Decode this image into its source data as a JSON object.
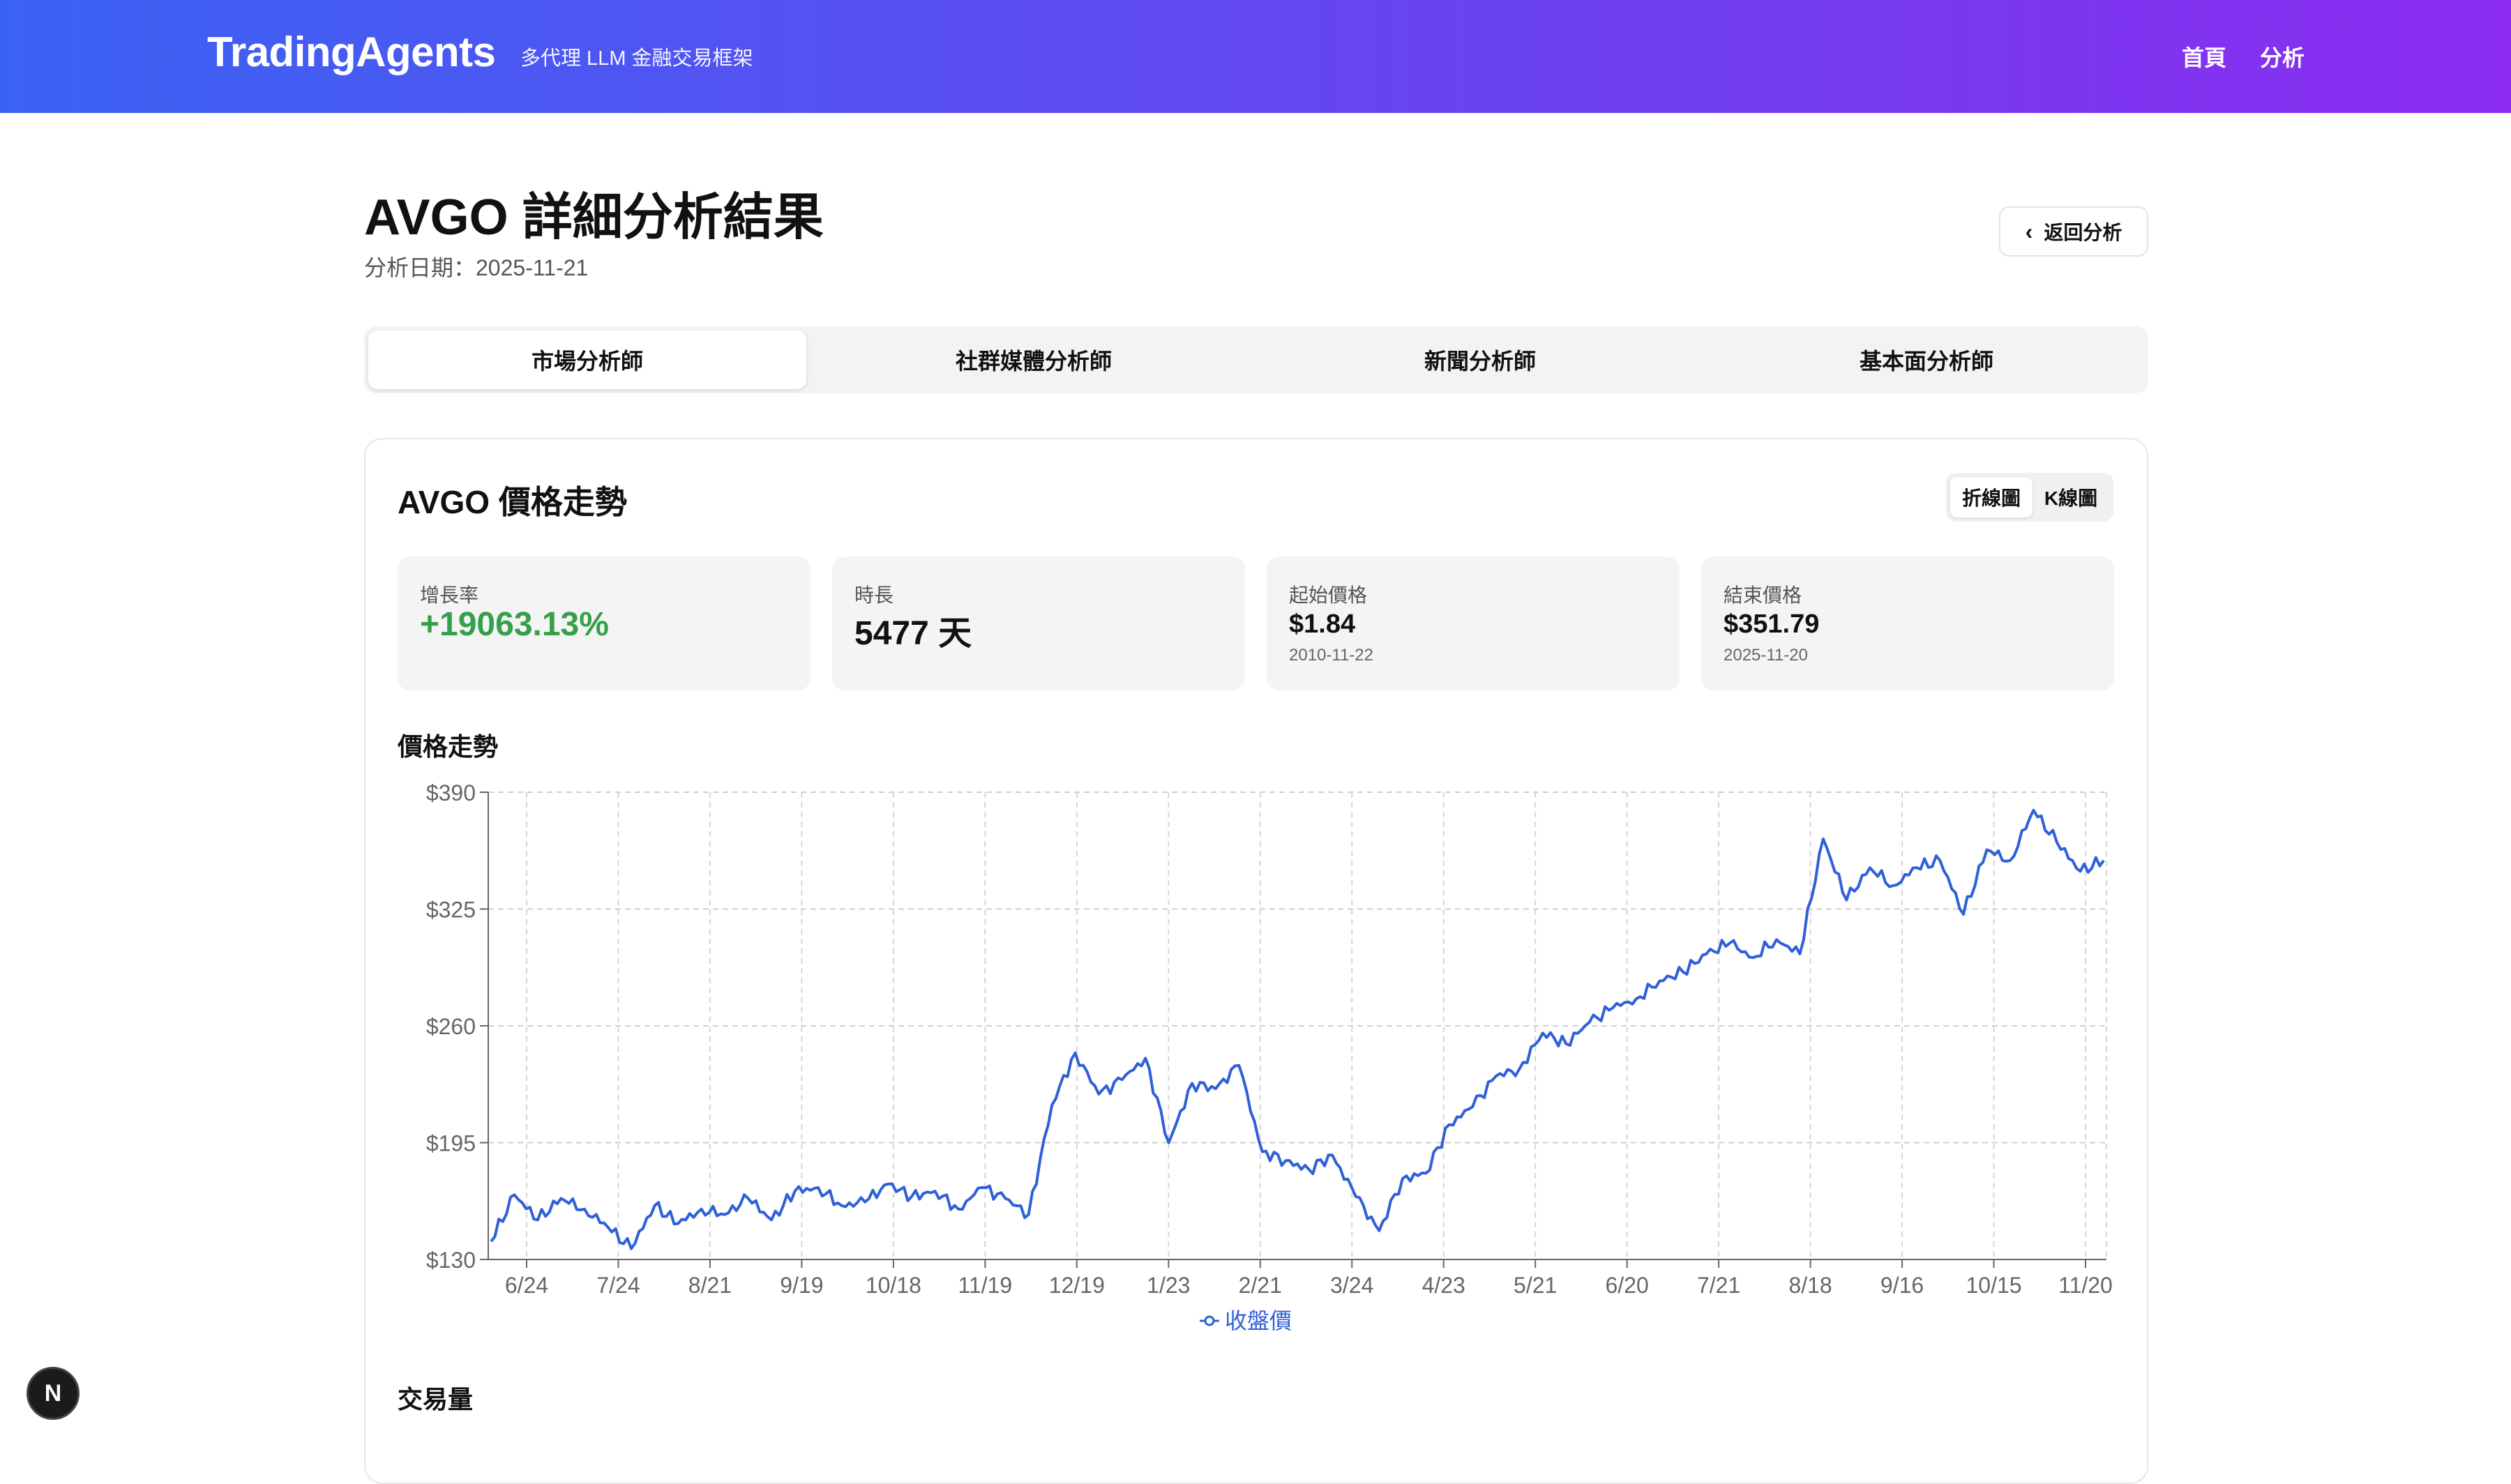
{
  "header": {
    "brand": "TradingAgents",
    "subtitle": "多代理 LLM 金融交易框架",
    "nav": {
      "home": "首頁",
      "analysis": "分析"
    }
  },
  "page": {
    "title": "AVGO 詳細分析結果",
    "date": "分析日期：2025-11-21",
    "back_label": "返回分析"
  },
  "tabs": [
    "市場分析師",
    "社群媒體分析師",
    "新聞分析師",
    "基本面分析師"
  ],
  "card": {
    "title": "AVGO 價格走勢",
    "toggle": [
      "折線圖",
      "K線圖"
    ]
  },
  "stats": [
    {
      "label": "增長率",
      "value": "+19063.13%",
      "date": ""
    },
    {
      "label": "時長",
      "value": "5477 天",
      "date": ""
    },
    {
      "label": "起始價格",
      "value": "$1.84",
      "date": "2010-11-22"
    },
    {
      "label": "結束價格",
      "value": "$351.79",
      "date": "2025-11-20"
    }
  ],
  "sections": {
    "price": "價格走勢",
    "volume": "交易量"
  },
  "badge": "N",
  "colors": {
    "line": "#3060d8",
    "growth": "#34a14a"
  },
  "chart_data": {
    "type": "line",
    "title": "價格走勢",
    "x": [
      "6/24",
      "7/24",
      "8/21",
      "9/19",
      "10/18",
      "11/19",
      "12/19",
      "1/23",
      "2/21",
      "3/24",
      "4/23",
      "5/21",
      "6/20",
      "7/21",
      "8/18",
      "9/16",
      "10/15",
      "11/20"
    ],
    "y_ticks": [
      "$390",
      "$325",
      "$260",
      "$195",
      "$130"
    ],
    "ylim": [
      130,
      390
    ],
    "grid": true,
    "legend": "bottom-center",
    "series": [
      {
        "name": "收盤價",
        "values": [
          140,
          166,
          152,
          164,
          158,
          148,
          136,
          160,
          150,
          158,
          155,
          164,
          152,
          168,
          170,
          160,
          162,
          172,
          165,
          168,
          158,
          170,
          164,
          155,
          216,
          245,
          222,
          230,
          242,
          195,
          228,
          225,
          238,
          190,
          185,
          180,
          188,
          165,
          146,
          175,
          178,
          205,
          215,
          232,
          236,
          256,
          250,
          262,
          270,
          275,
          285,
          290,
          300,
          306,
          298,
          308,
          300,
          364,
          330,
          348,
          338,
          348,
          352,
          322,
          358,
          352,
          380,
          362,
          346,
          352
        ]
      }
    ]
  }
}
